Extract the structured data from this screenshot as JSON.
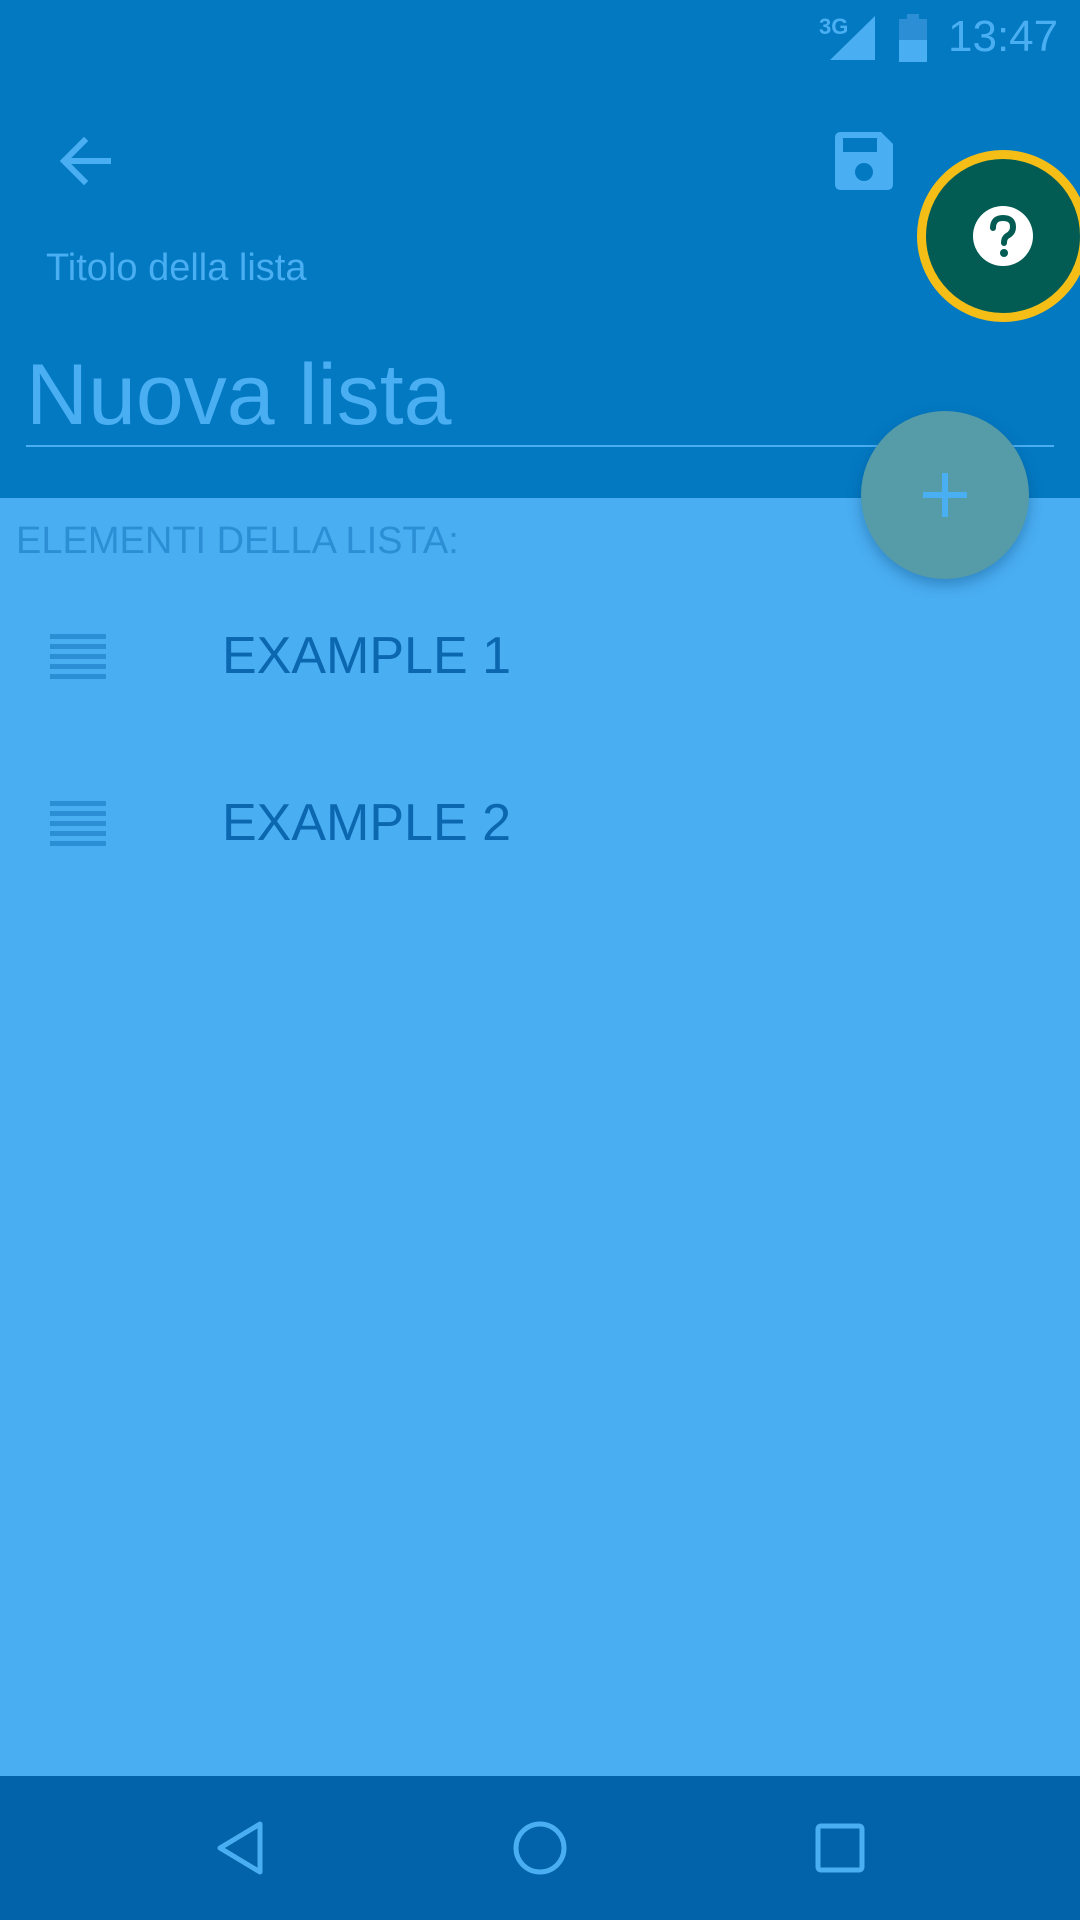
{
  "status_bar": {
    "network": "3G",
    "time": "13:47"
  },
  "app_bar": {
    "back_icon": "arrow-back-icon",
    "save_icon": "floppy-disk-icon",
    "help_icon": "help-circle-icon",
    "highlight_color": "#F4BE17"
  },
  "form": {
    "title_label": "Titolo della lista",
    "title_placeholder": "Nuova lista",
    "title_value": ""
  },
  "list": {
    "header": "ELEMENTI DELLA LISTA:",
    "items": [
      {
        "label": "EXAMPLE 1",
        "icon": "drag-handle-icon"
      },
      {
        "label": "EXAMPLE 2",
        "icon": "drag-handle-icon"
      }
    ]
  },
  "fab": {
    "icon": "plus-icon"
  },
  "nav_bar": {
    "back_icon": "nav-back-triangle-icon",
    "home_icon": "nav-home-circle-icon",
    "recents_icon": "nav-recents-square-icon"
  },
  "colors": {
    "primary_dark": "#0379C2",
    "background": "#4AAEF2",
    "accent_help": "#035C53",
    "fab": "#559BA8",
    "nav_bar": "#0263AA",
    "list_text": "#0B67B0"
  }
}
